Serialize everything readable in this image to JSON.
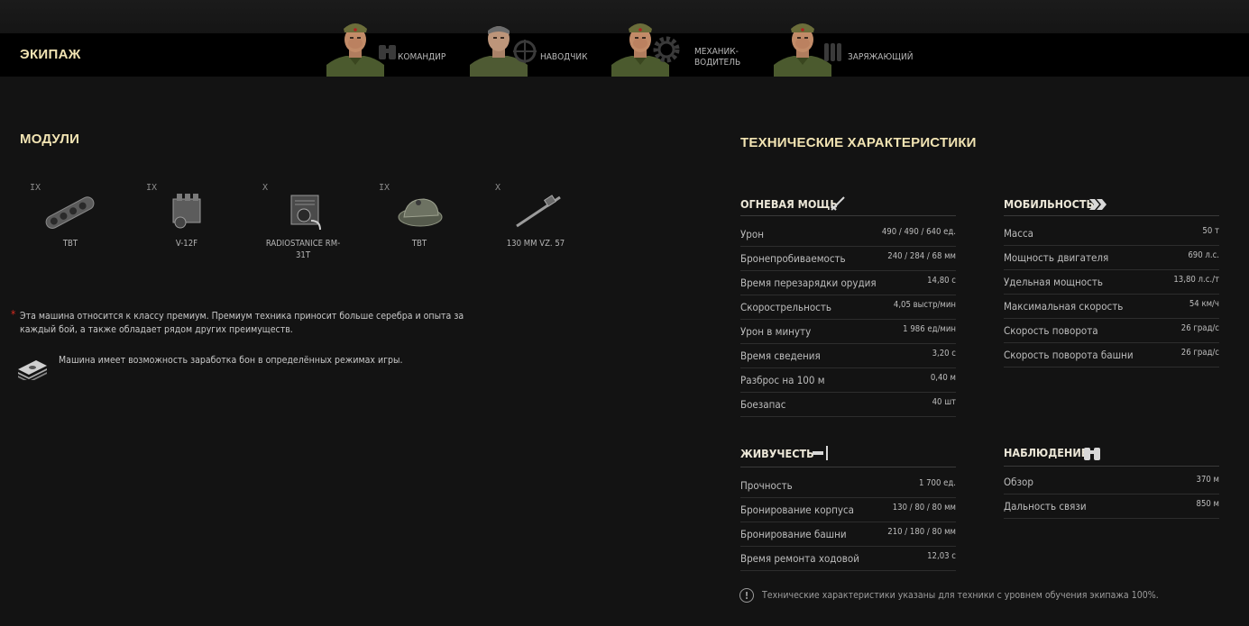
{
  "crew": {
    "title": "ЭКИПАЖ",
    "members": [
      {
        "role": "КОМАНДИР",
        "icon": "binoculars-icon"
      },
      {
        "role": "НАВОДЧИК",
        "icon": "crosshair-icon"
      },
      {
        "role": "МЕХАНИК-ВОДИТЕЛЬ",
        "icon": "gear-icon"
      },
      {
        "role": "ЗАРЯЖАЮЩИЙ",
        "icon": "shells-icon"
      }
    ]
  },
  "modules": {
    "title": "МОДУЛИ",
    "items": [
      {
        "tier": "IX",
        "name": "TBT",
        "icon": "tracks-icon"
      },
      {
        "tier": "IX",
        "name": "V-12F",
        "icon": "engine-icon"
      },
      {
        "tier": "X",
        "name": "RADIOSTANICE RM-31T",
        "icon": "radio-icon"
      },
      {
        "tier": "IX",
        "name": "TBT",
        "icon": "turret-icon"
      },
      {
        "tier": "X",
        "name": "130 MM VZ. 57",
        "icon": "gun-icon"
      }
    ]
  },
  "notes": {
    "premium": "Эта машина относится к классу премиум. Премиум техника приносит больше серебра и опыта за каждый бой, а также обладает рядом других преимуществ.",
    "bonds": "Машина имеет возможность заработка бон в определённых режимах игры."
  },
  "specs": {
    "title": "ТЕХНИЧЕСКИЕ ХАРАКТЕРИСТИКИ",
    "firepower": {
      "title": "ОГНЕВАЯ МОЩЬ",
      "rows": [
        {
          "label": "Урон",
          "value": "490 / 490 / 640 ед."
        },
        {
          "label": "Бронепробиваемость",
          "value": "240 / 284 / 68 мм"
        },
        {
          "label": "Время перезарядки орудия",
          "value": "14,80 с"
        },
        {
          "label": "Скорострельность",
          "value": "4,05 выстр/мин"
        },
        {
          "label": "Урон в минуту",
          "value": "1 986 ед/мин"
        },
        {
          "label": "Время сведения",
          "value": "3,20 с"
        },
        {
          "label": "Разброс на 100 м",
          "value": "0,40 м"
        },
        {
          "label": "Боезапас",
          "value": "40 шт"
        }
      ]
    },
    "mobility": {
      "title": "МОБИЛЬНОСТЬ",
      "rows": [
        {
          "label": "Масса",
          "value": "50 т"
        },
        {
          "label": "Мощность двигателя",
          "value": "690 л.с."
        },
        {
          "label": "Удельная мощность",
          "value": "13,80 л.с./т"
        },
        {
          "label": "Максимальная скорость",
          "value": "54 км/ч"
        },
        {
          "label": "Скорость поворота",
          "value": "26 град/с"
        },
        {
          "label": "Скорость поворота башни",
          "value": "26 град/с"
        }
      ]
    },
    "survivability": {
      "title": "ЖИВУЧЕСТЬ",
      "rows": [
        {
          "label": "Прочность",
          "value": "1 700 ед."
        },
        {
          "label": "Бронирование корпуса",
          "value": "130 / 80 / 80 мм"
        },
        {
          "label": "Бронирование башни",
          "value": "210 / 180 / 80 мм"
        },
        {
          "label": "Время ремонта ходовой",
          "value": "12,03 с"
        }
      ]
    },
    "observation": {
      "title": "НАБЛЮДЕНИЕ",
      "rows": [
        {
          "label": "Обзор",
          "value": "370 м"
        },
        {
          "label": "Дальность связи",
          "value": "850 м"
        }
      ]
    },
    "footnote": "Технические характеристики указаны для техники с уровнем обучения экипажа 100%."
  },
  "colors": {
    "accent": "#f2e4b3",
    "background": "#131313",
    "premium_star": "#d02a1f"
  }
}
